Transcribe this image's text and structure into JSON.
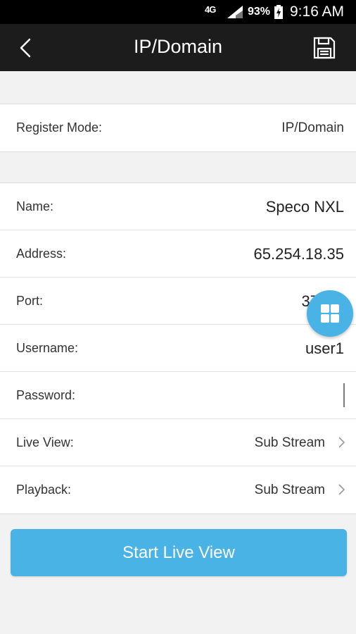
{
  "status_bar": {
    "network": "4G",
    "battery_percent": "93%",
    "time": "9:16 AM"
  },
  "header": {
    "title": "IP/Domain",
    "back_icon": "chevron-left-icon",
    "save_icon": "floppy-disk-icon"
  },
  "register": {
    "label": "Register Mode:",
    "value": "IP/Domain"
  },
  "fields": {
    "name": {
      "label": "Name:",
      "value": "Speco NXL"
    },
    "address": {
      "label": "Address:",
      "value": "65.254.18.35"
    },
    "port": {
      "label": "Port:",
      "value": "37"
    },
    "username": {
      "label": "Username:",
      "value": "user1"
    },
    "password": {
      "label": "Password:",
      "value": ""
    },
    "live_view": {
      "label": "Live View:",
      "value": "Sub Stream"
    },
    "playback": {
      "label": "Playback:",
      "value": "Sub Stream"
    }
  },
  "floating_menu_icon": "grid-icon",
  "start_button": {
    "label": "Start Live View"
  },
  "colors": {
    "accent": "#4ab3e6",
    "app_bar": "#1c1c1c",
    "background": "#f2f2f2"
  }
}
